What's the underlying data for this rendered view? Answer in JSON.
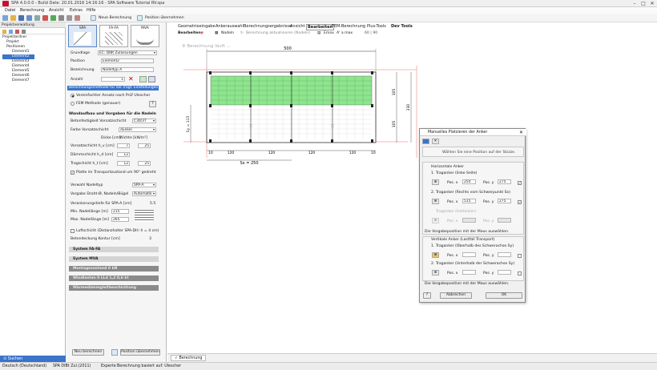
{
  "app": {
    "title": "SPA 4.0.0.0  -  Build Date: 20.01.2016 14:16:16  -  SPA Software Tutorial RV.spa",
    "window_controls": [
      "–",
      "□",
      "✕"
    ]
  },
  "menu": [
    "Datei",
    "Berechnung",
    "Ansicht",
    "Extras",
    "Hilfe"
  ],
  "toolbar": {
    "new_calc": "Neue Berechnung",
    "take_position": "Position übernehmen"
  },
  "left_panel": {
    "header": "Projektverwaltung",
    "tree": [
      {
        "label": "Projektordner",
        "level": 0
      },
      {
        "label": "Projekt",
        "level": 1
      },
      {
        "label": "Positionen",
        "level": 1
      },
      {
        "label": "Element1",
        "level": 2
      },
      {
        "label": "Element2",
        "level": 2
      },
      {
        "label": "Element3",
        "level": 2
      },
      {
        "label": "Element4",
        "level": 2
      },
      {
        "label": "Element5",
        "level": 2
      },
      {
        "label": "Element6",
        "level": 2
      },
      {
        "label": "Element7",
        "level": 2
      }
    ],
    "selected": "Element2",
    "search": "Suchen"
  },
  "mid": {
    "tabs": [
      {
        "label": "SPA"
      },
      {
        "label": "FA-FA"
      },
      {
        "label": "MVA"
      }
    ],
    "grundlage_label": "Grundlage",
    "grundlage_value": "EC: DIBt Zulassungen",
    "position_label": "Position",
    "position_value": "Element2",
    "bezeichnung_label": "Bezeichnung",
    "bezeichnung_value": "Nadeltyp A",
    "anzahl_label": "Anzahl",
    "anzahl_value": "1",
    "method_header": "Berechnungsmethode für die Tragf. Einstellungen",
    "radio1": "Vereinfachter Ansatz nach Prüf Ulescher",
    "radio2": "FEM Methode (genauer)",
    "wand_header": "Wandaufbau und Vorgaben für die Nadeln",
    "beton_label": "Betonfestigkeit Vorsatzschicht",
    "beton_value": "C30/37",
    "farbe_label": "Farbe Vorsatzschicht",
    "farbe_value": "dunkel",
    "dicke_hdr": "Dicke [cm]",
    "wichte_hdr": "Wichte [kN/m³]",
    "vorsatz_label": "Vorsatzschicht  h_v  [cm]",
    "vorsatz_d": "7",
    "vorsatz_w": "25",
    "daemm_label": "Dämmschicht  h_d  [cm]",
    "daemm_d": "12",
    "trag_label": "Tragschicht  h_t  [cm]",
    "trag_d": "12",
    "trag_w": "25",
    "platte_label": "Platte im Transportzustand um 90° gedreht",
    "nadeltyp_label": "Verwahl Nadeltyp",
    "nadeltyp_value": "SPA-A",
    "vorgabe_label": "Vorgabe Draht-Ø, Nadeln/Bügel",
    "vorgabe_value": "Automatik",
    "veranker_label": "Verankerungstiefe für SPA-A  [cm]",
    "veranker_value": "5.5",
    "minlen_label": "Min. Nadellänge  [m]",
    "minlen_value": "215",
    "maxlen_label": "Max. Nadellänge  [m]",
    "maxlen_value": "265",
    "luft_label": "Luftschicht (Distanzhalter SPA-DH: h = 4 cm)",
    "kontur_label": "Betondeckung Kontur  [cm]",
    "kontur_value": "3",
    "sections": [
      {
        "label": "System FA-FA",
        "dark": false
      },
      {
        "label": "System MVA",
        "dark": false
      },
      {
        "label": "Montagezustand     0 kN",
        "dark": true
      },
      {
        "label": "Windlasten     0 LLd  1,2     0,6 kt",
        "dark": true
      },
      {
        "label": "Wärmedämmgleitbeschichtung",
        "dark": true
      }
    ],
    "btn_new": "Neu berechnen",
    "btn_take": "Position übernehmen"
  },
  "rtabs": [
    "Geometrieeingabe",
    "Ankerauswahl",
    "Berechnungsergebnisse",
    "Ansicht",
    "Bearbeiten",
    "FEM-Berechnung",
    "Plus-Tools",
    "Dev Tools"
  ],
  "rtabs_active": "Bearbeiten",
  "rtool": {
    "edit": "Bearbeiten",
    "nadeln": "Nadeln",
    "aktual": "Berechnung aktualisieren (Nadeln)",
    "emax": "Emax",
    "amax": "A' a max",
    "dim": "60 | 90"
  },
  "canvas": {
    "busy": "Berechnung läuft ...",
    "dim_top": "500",
    "dim_right1": "105",
    "dim_right2": "105",
    "dim_right_total": "230",
    "dim_left": "Sy = 115",
    "bottom_dims": [
      "10",
      "120",
      "120",
      "120",
      "120",
      "10"
    ],
    "sx": "Sx = 250",
    "accent": "#f2a3a3",
    "green": "#8ee58e"
  },
  "bottom_tab": "Berechnung",
  "dialog": {
    "title": "Manuelles Platzieren der Anker",
    "hint": "Wählen Sie eine Position auf der Skizze.",
    "horiz": "Horizontale Anker",
    "ha1": "1. Traganker (linke Seite)",
    "ha1_x": "250",
    "ha1_y": "275",
    "ha2": "2. Traganker (Rechts vom Schwerpunkt Sx)",
    "ha2_x": "515",
    "ha2_y": "275",
    "ha3": "Traganker (Haltanker)",
    "posx": "Pos. x",
    "posy": "Pos. y",
    "note1": "Die Vorgabeposition mit der Maus auswählen.",
    "vert": "Vertikale Anker (Lastfall Transport)",
    "va1": "1. Traganker (Oberhalb des Schwerachse Sy)",
    "va2": "2. Traganker (Unterhalb der Schwerachse Sy)",
    "note2": "Die Vorgabeposition mit der Maus auswählen.",
    "cancel": "Abbrechen",
    "ok": "OK",
    "help": "?"
  },
  "status": {
    "lang": "Deutsch (Deutschland)",
    "norm": "SPA DIBt Zul.(2011)",
    "mode": "Experte",
    "basis": "Berechnung basiert auf: Ulescher"
  }
}
